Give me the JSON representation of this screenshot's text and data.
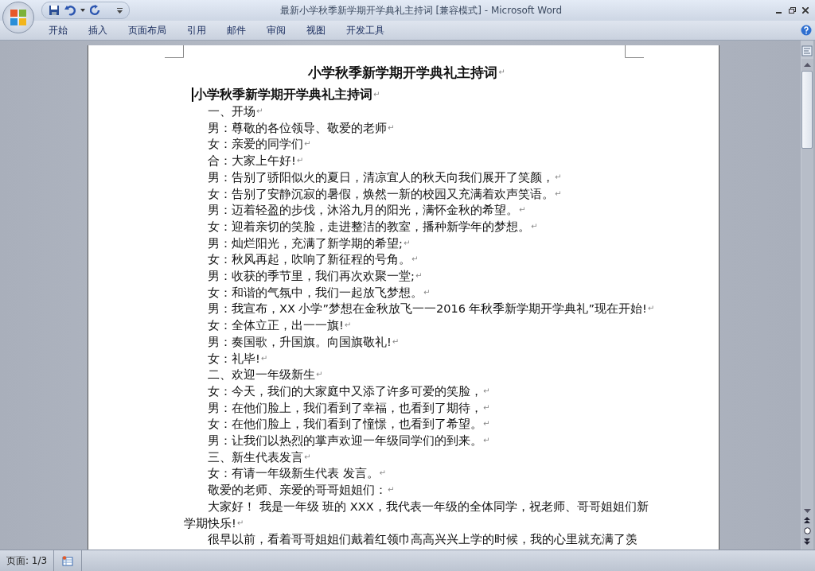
{
  "window": {
    "title": "最新小学秋季新学期开学典礼主持词 [兼容模式] - Microsoft Word"
  },
  "ribbon_tabs": [
    {
      "label": "开始",
      "selected": false
    },
    {
      "label": "插入",
      "selected": false
    },
    {
      "label": "页面布局",
      "selected": false
    },
    {
      "label": "引用",
      "selected": false
    },
    {
      "label": "邮件",
      "selected": false
    },
    {
      "label": "审阅",
      "selected": false
    },
    {
      "label": "视图",
      "selected": false
    },
    {
      "label": "开发工具",
      "selected": false
    }
  ],
  "document": {
    "paragraph_mark": "↵",
    "lines": [
      {
        "kind": "title",
        "text": "小学秋季新学期开学典礼主持词",
        "mark": true
      },
      {
        "kind": "heading",
        "text": "小学秋季新学期开学典礼主持词",
        "mark": true
      },
      {
        "kind": "body",
        "text": "一、开场",
        "mark": true
      },
      {
        "kind": "body",
        "text": "男：尊敬的各位领导、敬爱的老师",
        "mark": true
      },
      {
        "kind": "body",
        "text": "女：亲爱的同学们",
        "mark": true
      },
      {
        "kind": "body",
        "text": "合：大家上午好!",
        "mark": true
      },
      {
        "kind": "body",
        "text": "男：告别了骄阳似火的夏日，清凉宜人的秋天向我们展开了笑颜，",
        "mark": true
      },
      {
        "kind": "body",
        "text": "女：告别了安静沉寂的暑假，焕然一新的校园又充满着欢声笑语。",
        "mark": true
      },
      {
        "kind": "body",
        "text": "男：迈着轻盈的步伐，沐浴九月的阳光，满怀金秋的希望。",
        "mark": true
      },
      {
        "kind": "body",
        "text": "女：迎着亲切的笑脸，走进整洁的教室，播种新学年的梦想。",
        "mark": true
      },
      {
        "kind": "body",
        "text": "男：灿烂阳光，充满了新学期的希望;",
        "mark": true
      },
      {
        "kind": "body",
        "text": "女：秋风再起，吹响了新征程的号角。",
        "mark": true
      },
      {
        "kind": "body",
        "text": "男：收获的季节里，我们再次欢聚一堂;",
        "mark": true
      },
      {
        "kind": "body",
        "text": "女：和谐的气氛中，我们一起放飞梦想。",
        "mark": true
      },
      {
        "kind": "body",
        "text": "男：我宣布，XX 小学”梦想在金秋放飞一一2016 年秋季新学期开学典礼”现在开始!",
        "mark": true
      },
      {
        "kind": "body",
        "text": "女：全体立正，出一一旗!",
        "mark": true
      },
      {
        "kind": "body",
        "text": "男：奏国歌，升国旗。向国旗敬礼!",
        "mark": true
      },
      {
        "kind": "body",
        "text": "女：礼毕!",
        "mark": true
      },
      {
        "kind": "body",
        "text": "二、欢迎一年级新生",
        "mark": true
      },
      {
        "kind": "body",
        "text": "女：今天，我们的大家庭中又添了许多可爱的笑脸，",
        "mark": true
      },
      {
        "kind": "body",
        "text": "男：在他们脸上，我们看到了幸福，也看到了期待，",
        "mark": true
      },
      {
        "kind": "body",
        "text": "女：在他们脸上，我们看到了憧憬，也看到了希望。",
        "mark": true
      },
      {
        "kind": "body",
        "text": "男：让我们以热烈的掌声欢迎一年级同学们的到来。",
        "mark": true
      },
      {
        "kind": "body",
        "text": "三、新生代表发言",
        "mark": true
      },
      {
        "kind": "body",
        "text": "女：有请一年级新生代表 发言。",
        "mark": true
      },
      {
        "kind": "body",
        "text": "敬爱的老师、亲爱的哥哥姐姐们：",
        "mark": true
      },
      {
        "kind": "body",
        "text": "大家好！ 我是一年级  班的 XXX，我代表一年级的全体同学，祝老师、哥哥姐姐们新",
        "mark": false
      },
      {
        "kind": "wrap",
        "text": "学期快乐!",
        "mark": true
      },
      {
        "kind": "body",
        "text": "很早以前，看着哥哥姐姐们戴着红领巾高高兴兴上学的时候，我的心里就充满了羡",
        "mark": false
      }
    ]
  },
  "status_bar": {
    "page": "页面: 1/3"
  }
}
